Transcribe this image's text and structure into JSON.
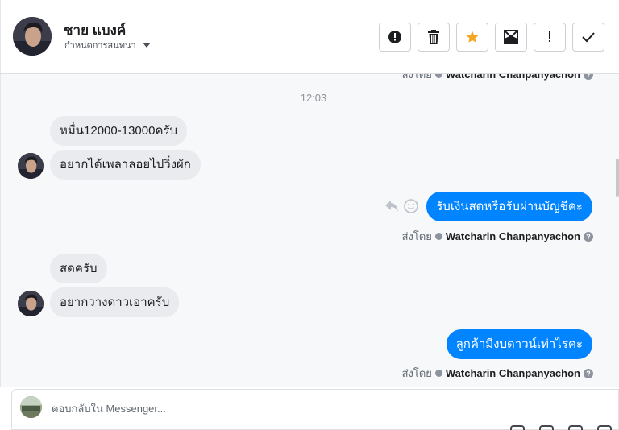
{
  "header": {
    "contact_name": "ชาย แบงค์",
    "contact_sub": "กำหนดการสนทนา",
    "toolbar": [
      {
        "name": "alert-button",
        "icon": "alert-circle-icon"
      },
      {
        "name": "delete-button",
        "icon": "trash-icon"
      },
      {
        "name": "star-button",
        "icon": "star-icon"
      },
      {
        "name": "mark-unread-button",
        "icon": "envelope-icon"
      },
      {
        "name": "important-button",
        "icon": "exclamation-icon"
      },
      {
        "name": "done-button",
        "icon": "check-icon"
      }
    ]
  },
  "thread": {
    "top_sent_by": {
      "label": "ส่งโดย",
      "name": "Watcharin Chanpanyachon"
    },
    "time": "12:03",
    "messages": [
      {
        "dir": "in",
        "text": "หมื่น12000-13000ครับ"
      },
      {
        "dir": "in",
        "text": "อยากได้เพลาลอยไปวิ่งผัก"
      },
      {
        "dir": "out",
        "text": "รับเงินสดหรือรับผ่านบัญชีคะ",
        "sent_label": "ส่งโดย",
        "sent_by": "Watcharin Chanpanyachon"
      },
      {
        "dir": "in",
        "text": "สดครับ"
      },
      {
        "dir": "in",
        "text": "อยากวางดาวเอาครับ"
      },
      {
        "dir": "out",
        "text": "ลูกค้ามีงบดาวน์เท่าไรคะ",
        "sent_label": "ส่งโดย",
        "sent_by": "Watcharin Chanpanyachon"
      }
    ]
  },
  "composer": {
    "placeholder": "ตอบกลับใน Messenger..."
  },
  "colors": {
    "accent": "#0084ff",
    "star": "#f5a623",
    "incoming_bubble": "#e9ebee"
  }
}
